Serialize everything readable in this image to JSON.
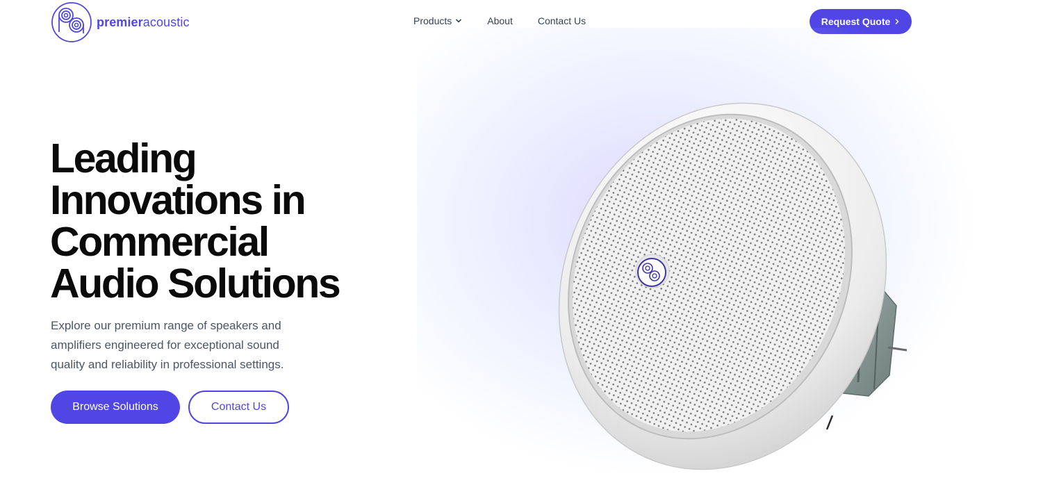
{
  "brand": {
    "name_bold": "premier",
    "name_light": "acoustic"
  },
  "nav": {
    "products": "Products",
    "about": "About",
    "contact": "Contact Us"
  },
  "header": {
    "cta": "Request Quote"
  },
  "hero": {
    "title_lines": [
      "Leading",
      "Innovations in",
      "Commercial",
      "Audio Solutions"
    ],
    "subtitle_lines": [
      "Explore our premium range of speakers and",
      "amplifiers engineered for exceptional sound",
      "quality and reliability in professional settings."
    ],
    "primary_button": "Browse Solutions",
    "secondary_button": "Contact Us"
  },
  "colors": {
    "accent": "#4f46e5",
    "text": "#0a0a0a",
    "muted": "#4b5563"
  },
  "icons": {
    "logo": "pa-swirl-logo-icon",
    "dropdown": "chevron-down-icon",
    "cta_arrow": "chevron-right-icon"
  }
}
